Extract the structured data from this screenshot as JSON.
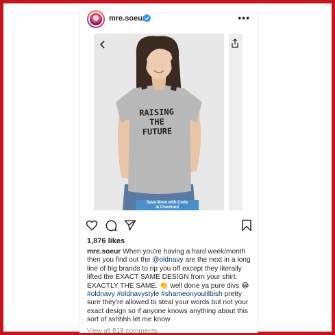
{
  "post": {
    "username": "mre.soeur",
    "more_label": "•••",
    "media": {
      "shirt_text": "RAISING\nTHE\nFUTURE",
      "promo_banner": "Save More with Code\nat Checkout"
    },
    "likes": "1,876 likes",
    "caption": {
      "username": "mre.soeur",
      "text_1": " When you're having a hard week/month then you find out the ",
      "mention": "@oldnavy",
      "text_2": " are the next in a long line of big brands to rip you off except they literally lifted the EXACT SAME DESIGN from your shirt. EXACTLY THE SAME. 👏 well done ya pure divs 😂 ",
      "tags": "#oldnavy #oldnavystyle #shameonyoulilbish",
      "text_3": " pretty sure they're allowed to steal your words but not your exact design so if anyone knows anything about this sort of sshhhh let me know"
    },
    "comments_link": "View all 818 comments"
  },
  "icons": [
    "chevron-left-icon",
    "share-icon",
    "heart-icon",
    "comment-icon",
    "send-icon",
    "bookmark-icon",
    "verified-icon"
  ],
  "colors": {
    "frame": "#c4161c",
    "link": "#00376b",
    "verified": "#3897f0",
    "promo": "#4a90c8"
  }
}
